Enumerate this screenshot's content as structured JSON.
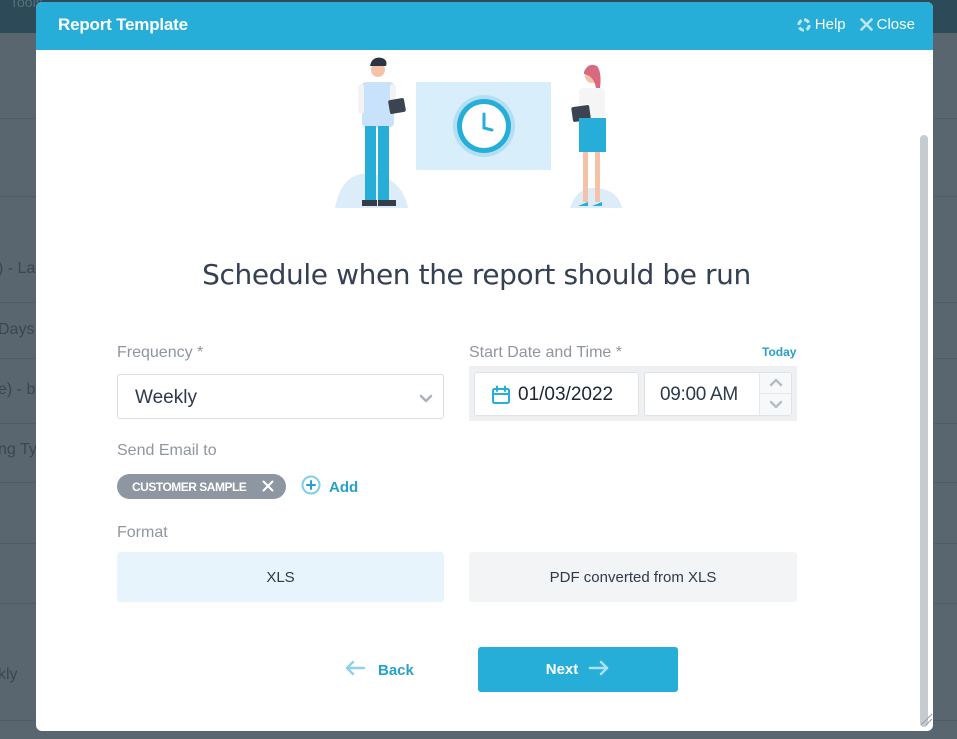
{
  "background": {
    "topbar_text": "Tools",
    "rows": [
      ") - La",
      "Days",
      "e) - by",
      "ng Ty",
      "kly"
    ]
  },
  "dialog": {
    "title": "Report Template",
    "help_label": "Help",
    "close_label": "Close",
    "heading": "Schedule when the report should be run",
    "frequency": {
      "label": "Frequency *",
      "value": "Weekly"
    },
    "start": {
      "label": "Start Date and Time *",
      "today_label": "Today",
      "date_value": "01/03/2022",
      "time_value": "09:00 AM"
    },
    "email": {
      "label": "Send Email to",
      "recipients": [
        "CUSTOMER SAMPLE"
      ],
      "add_label": "Add"
    },
    "format": {
      "label": "Format",
      "options": [
        "XLS",
        "PDF converted from XLS"
      ],
      "selected": "XLS"
    },
    "back_label": "Back",
    "next_label": "Next"
  },
  "colors": {
    "accent": "#26aed8",
    "link": "#26a1c8",
    "chip": "#8e96a2",
    "selected_option": "#e8f4fb",
    "overlay": "#596670"
  }
}
